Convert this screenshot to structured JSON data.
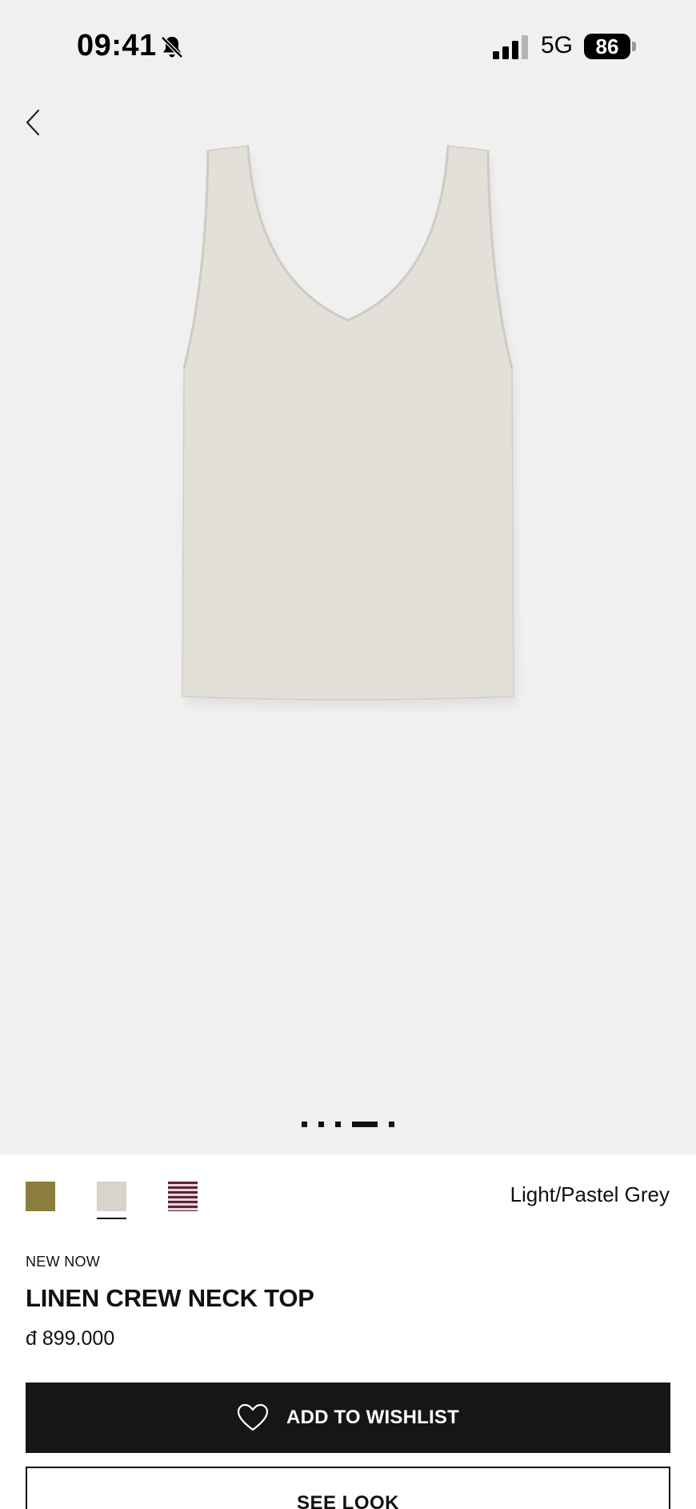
{
  "status_bar": {
    "time": "09:41",
    "network": "5G",
    "battery": "86",
    "icons": [
      "bell-slash-icon",
      "signal-icon",
      "battery-icon"
    ]
  },
  "navigation": {
    "back_icon": "chevron-left-icon"
  },
  "gallery": {
    "image": "sleeveless linen tank top, light grey",
    "page_count": 5,
    "active_page": 4
  },
  "product": {
    "swatches": [
      {
        "name": "olive",
        "color": "#8a7d3e"
      },
      {
        "name": "light-grey",
        "color": "#d8d4cb",
        "selected": true
      },
      {
        "name": "burgundy-stripe",
        "color": "#5a2438"
      }
    ],
    "selected_color": "Light/Pastel Grey",
    "tag": "NEW NOW",
    "title": "LINEN CREW NECK TOP",
    "price": "đ 899.000"
  },
  "actions": {
    "wishlist_label": "ADD TO WISHLIST",
    "wishlist_icon": "heart-icon",
    "see_look_label": "SEE LOOK"
  }
}
